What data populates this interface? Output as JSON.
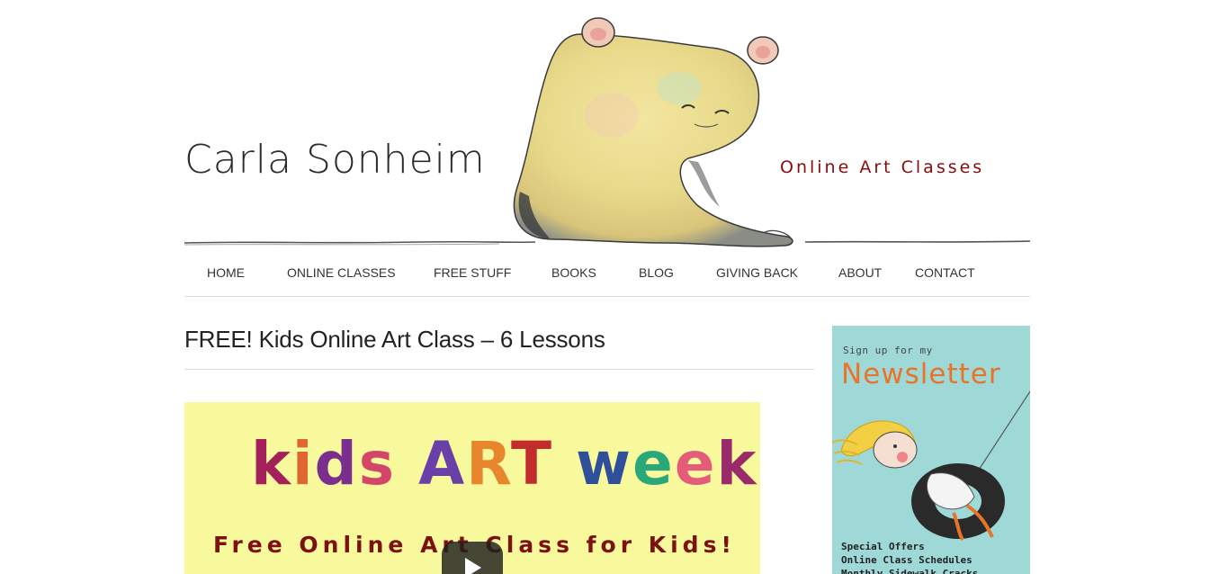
{
  "header": {
    "site_title": "Carla Sonheim",
    "tagline": "Online Art Classes"
  },
  "nav": {
    "items": [
      {
        "label": "HOME"
      },
      {
        "label": "ONLINE CLASSES"
      },
      {
        "label": "FREE STUFF"
      },
      {
        "label": "BOOKS"
      },
      {
        "label": "BLOG"
      },
      {
        "label": "GIVING BACK"
      },
      {
        "label": "ABOUT"
      },
      {
        "label": "CONTACT"
      }
    ]
  },
  "main": {
    "post_title": "FREE! Kids Online Art Class – 6 Lessons",
    "video": {
      "line1_letters": [
        {
          "ch": "k",
          "color": "#a3205a"
        },
        {
          "ch": "i",
          "color": "#e0662f"
        },
        {
          "ch": "d",
          "color": "#7a2f8f"
        },
        {
          "ch": "s",
          "color": "#d4456a"
        },
        {
          "ch": " ",
          "color": "#000000"
        },
        {
          "ch": "A",
          "color": "#6a3fa8"
        },
        {
          "ch": "R",
          "color": "#e8862e"
        },
        {
          "ch": "T",
          "color": "#c32c2c"
        },
        {
          "ch": " ",
          "color": "#000000"
        },
        {
          "ch": "w",
          "color": "#2f4f9a"
        },
        {
          "ch": "e",
          "color": "#2aa87a"
        },
        {
          "ch": "e",
          "color": "#e35c7a"
        },
        {
          "ch": "k",
          "color": "#9a2b6a"
        }
      ],
      "subtitle": "Free Online Art Class for Kids!"
    }
  },
  "sidebar": {
    "newsletter_small": "Sign up for my",
    "newsletter_big": "Newsletter",
    "list": [
      "Special Offers",
      "Online Class Schedules",
      "Monthly Sidewalk Cracks"
    ]
  },
  "colors": {
    "tagline": "#8b0a0a",
    "newsletter_bg": "#9fd9d7",
    "newsletter_title": "#e8742a",
    "video_bg": "#f7f99c"
  }
}
